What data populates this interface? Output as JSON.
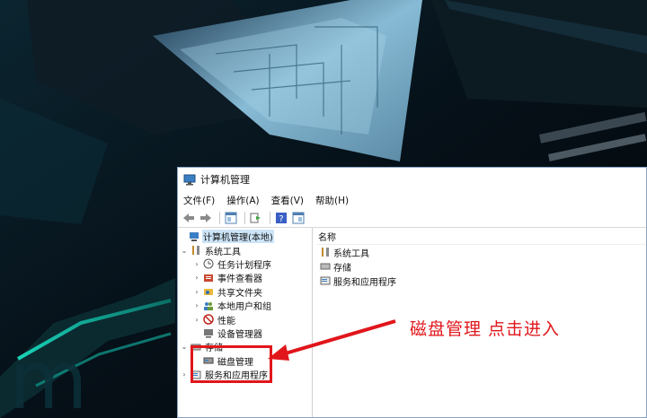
{
  "window": {
    "title": "计算机管理",
    "menu": [
      "文件(F)",
      "操作(A)",
      "查看(V)",
      "帮助(H)"
    ]
  },
  "tree": {
    "root": "计算机管理(本地)",
    "system_tools": "系统工具",
    "task_scheduler": "任务计划程序",
    "event_viewer": "事件查看器",
    "shared_folders": "共享文件夹",
    "local_users": "本地用户和组",
    "performance": "性能",
    "device_manager": "设备管理器",
    "storage": "存储",
    "disk_management": "磁盘管理",
    "services_apps": "服务和应用程序"
  },
  "content": {
    "column_name": "名称",
    "items": [
      "系统工具",
      "存储",
      "服务和应用程序"
    ]
  },
  "annotation": {
    "text": "磁盘管理  点击进入",
    "color": "#e0161b"
  },
  "icons": {
    "app": "computer-management-icon",
    "toolbar": [
      "back-icon",
      "forward-icon",
      "console-tree-icon",
      "export-icon",
      "help-icon",
      "view-icon"
    ]
  }
}
